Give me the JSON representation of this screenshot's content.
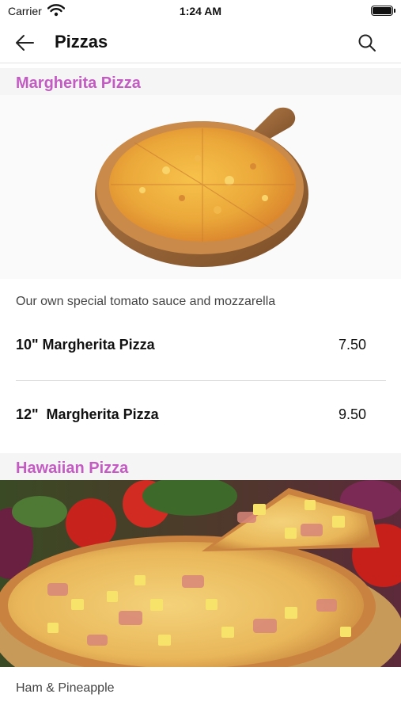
{
  "status_bar": {
    "carrier": "Carrier",
    "time": "1:24 AM"
  },
  "nav": {
    "title": "Pizzas",
    "back_icon": "arrow-left-icon",
    "search_icon": "search-icon"
  },
  "sections": [
    {
      "title": "Margherita Pizza",
      "description": "Our own special tomato sauce and mozzarella",
      "items": [
        {
          "name": "10\" Margherita Pizza",
          "price": "7.50"
        },
        {
          "name": "12\"  Margherita Pizza",
          "price": "9.50"
        }
      ]
    },
    {
      "title": "Hawaiian Pizza",
      "description": "Ham & Pineapple"
    }
  ],
  "colors": {
    "section_title": "#c35bc3",
    "section_bg": "#f5f5f5",
    "divider": "#d8d8d8"
  }
}
